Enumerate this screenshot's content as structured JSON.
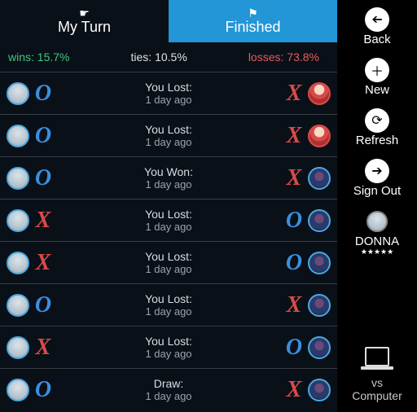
{
  "tabs": {
    "myturn": {
      "icon": "☛",
      "label": "My Turn"
    },
    "finished": {
      "icon": "⚑",
      "label": "Finished"
    }
  },
  "stats": {
    "wins_label": "wins:",
    "wins_val": "15.7%",
    "ties_label": "ties:",
    "ties_val": "10.5%",
    "losses_label": "losses:",
    "losses_val": "73.8%"
  },
  "rows": [
    {
      "leftMark": "O",
      "result": "You Lost:",
      "time": "1 day ago",
      "rightMark": "X",
      "rightAvatar": "img1 red"
    },
    {
      "leftMark": "O",
      "result": "You Lost:",
      "time": "1 day ago",
      "rightMark": "X",
      "rightAvatar": "img1 red"
    },
    {
      "leftMark": "O",
      "result": "You Won:",
      "time": "1 day ago",
      "rightMark": "X",
      "rightAvatar": "img2"
    },
    {
      "leftMark": "X",
      "result": "You Lost:",
      "time": "1 day ago",
      "rightMark": "O",
      "rightAvatar": "img2"
    },
    {
      "leftMark": "X",
      "result": "You Lost:",
      "time": "1 day ago",
      "rightMark": "O",
      "rightAvatar": "img2"
    },
    {
      "leftMark": "O",
      "result": "You Lost:",
      "time": "1 day ago",
      "rightMark": "X",
      "rightAvatar": "img2"
    },
    {
      "leftMark": "X",
      "result": "You Lost:",
      "time": "1 day ago",
      "rightMark": "O",
      "rightAvatar": "img2"
    },
    {
      "leftMark": "O",
      "result": "Draw:",
      "time": "1 day ago",
      "rightMark": "X",
      "rightAvatar": "img2"
    }
  ],
  "side": {
    "back": {
      "icon": "➔",
      "label": "Back"
    },
    "new": {
      "icon": "＋",
      "label": "New"
    },
    "refresh": {
      "icon": "⟳",
      "label": "Refresh"
    },
    "signout": {
      "icon": "➔",
      "label": "Sign Out"
    },
    "user": {
      "label": "DONNA",
      "stars": "★★★★★"
    },
    "vs": {
      "line1": "vs",
      "line2": "Computer"
    }
  }
}
